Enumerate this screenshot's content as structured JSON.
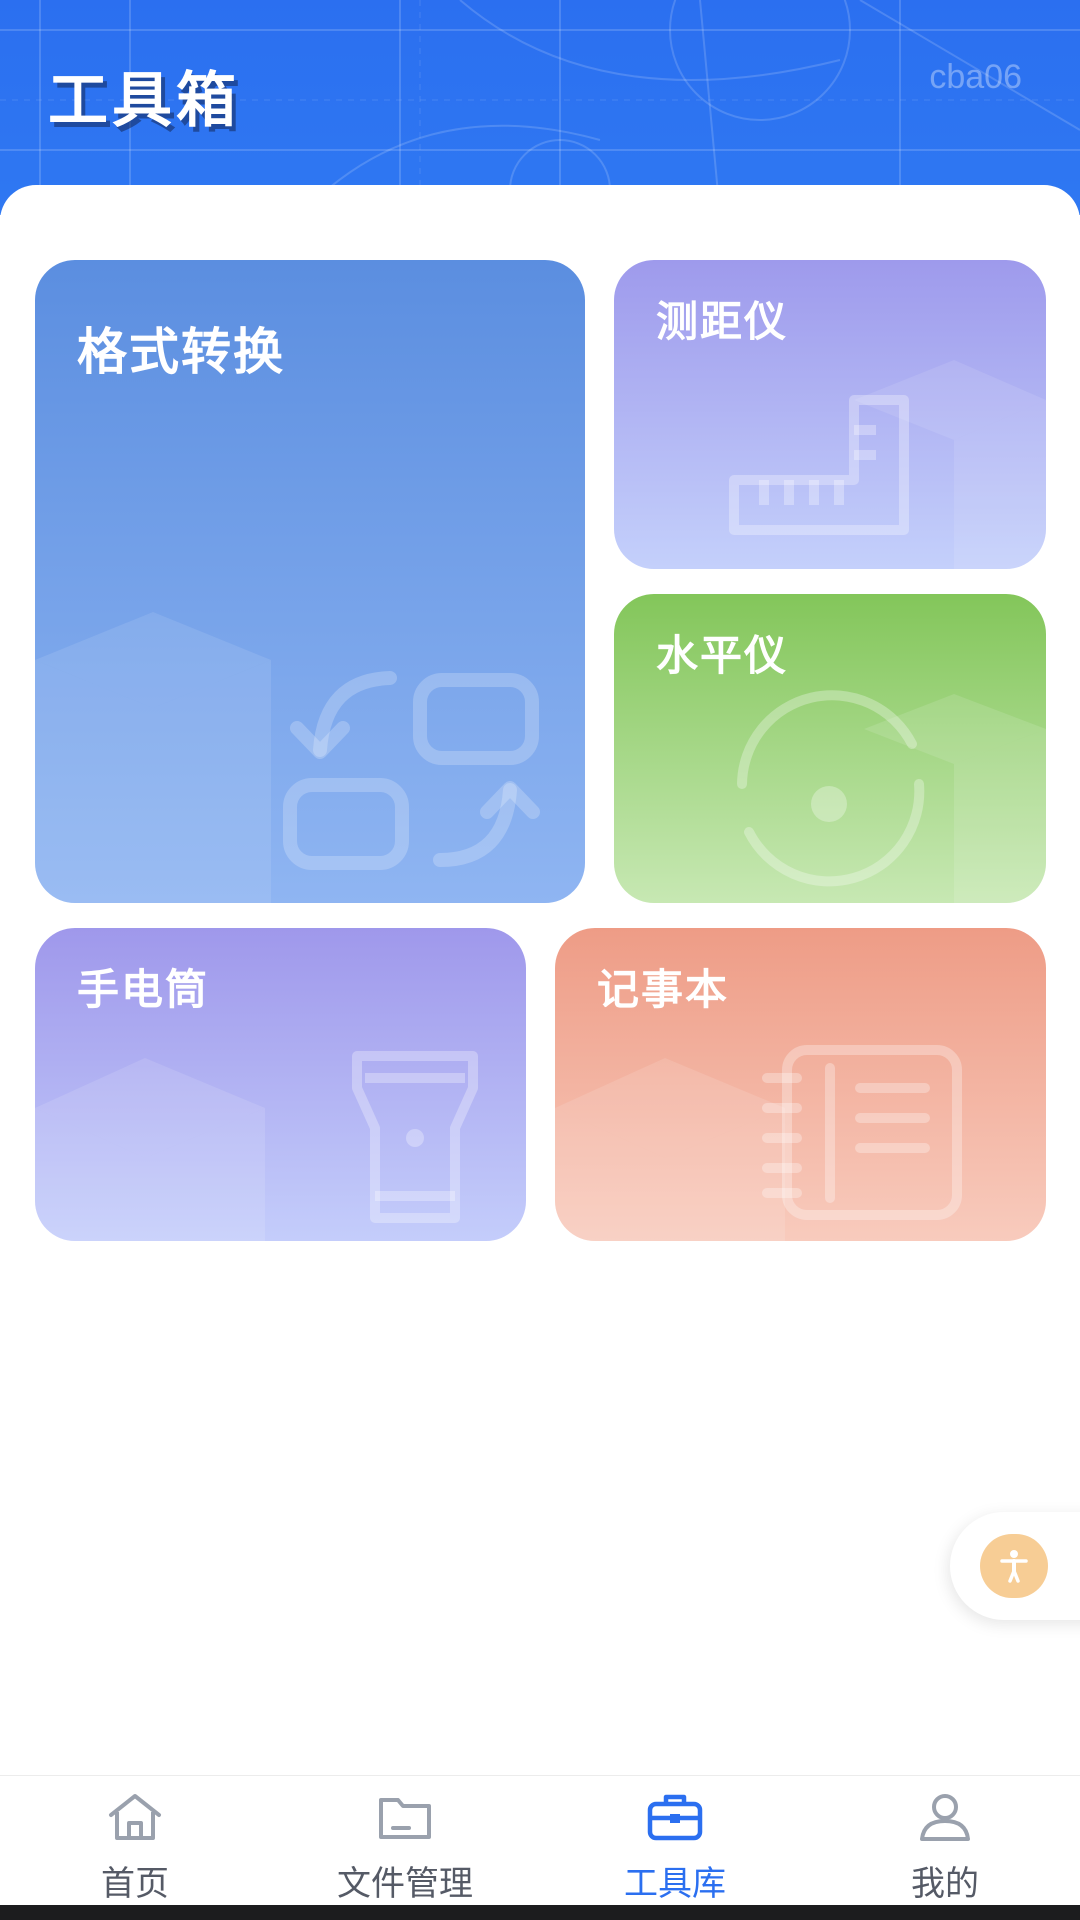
{
  "header": {
    "title": "工具箱",
    "code": "cba06"
  },
  "tools": [
    {
      "label": "格式转换",
      "icon": "convert-icon"
    },
    {
      "label": "测距仪",
      "icon": "ruler-icon"
    },
    {
      "label": "水平仪",
      "icon": "level-icon"
    },
    {
      "label": "手电筒",
      "icon": "flashlight-icon"
    },
    {
      "label": "记事本",
      "icon": "notebook-icon"
    }
  ],
  "float_button": {
    "icon": "accessibility-icon"
  },
  "nav": {
    "items": [
      {
        "label": "首页",
        "icon": "home-icon"
      },
      {
        "label": "文件管理",
        "icon": "folder-icon"
      },
      {
        "label": "工具库",
        "icon": "toolbox-icon"
      },
      {
        "label": "我的",
        "icon": "user-icon"
      }
    ],
    "active_index": 2
  },
  "colors": {
    "brand": "#2b6ff0",
    "nav_inactive": "#555a66",
    "float": "#f7cd95"
  }
}
